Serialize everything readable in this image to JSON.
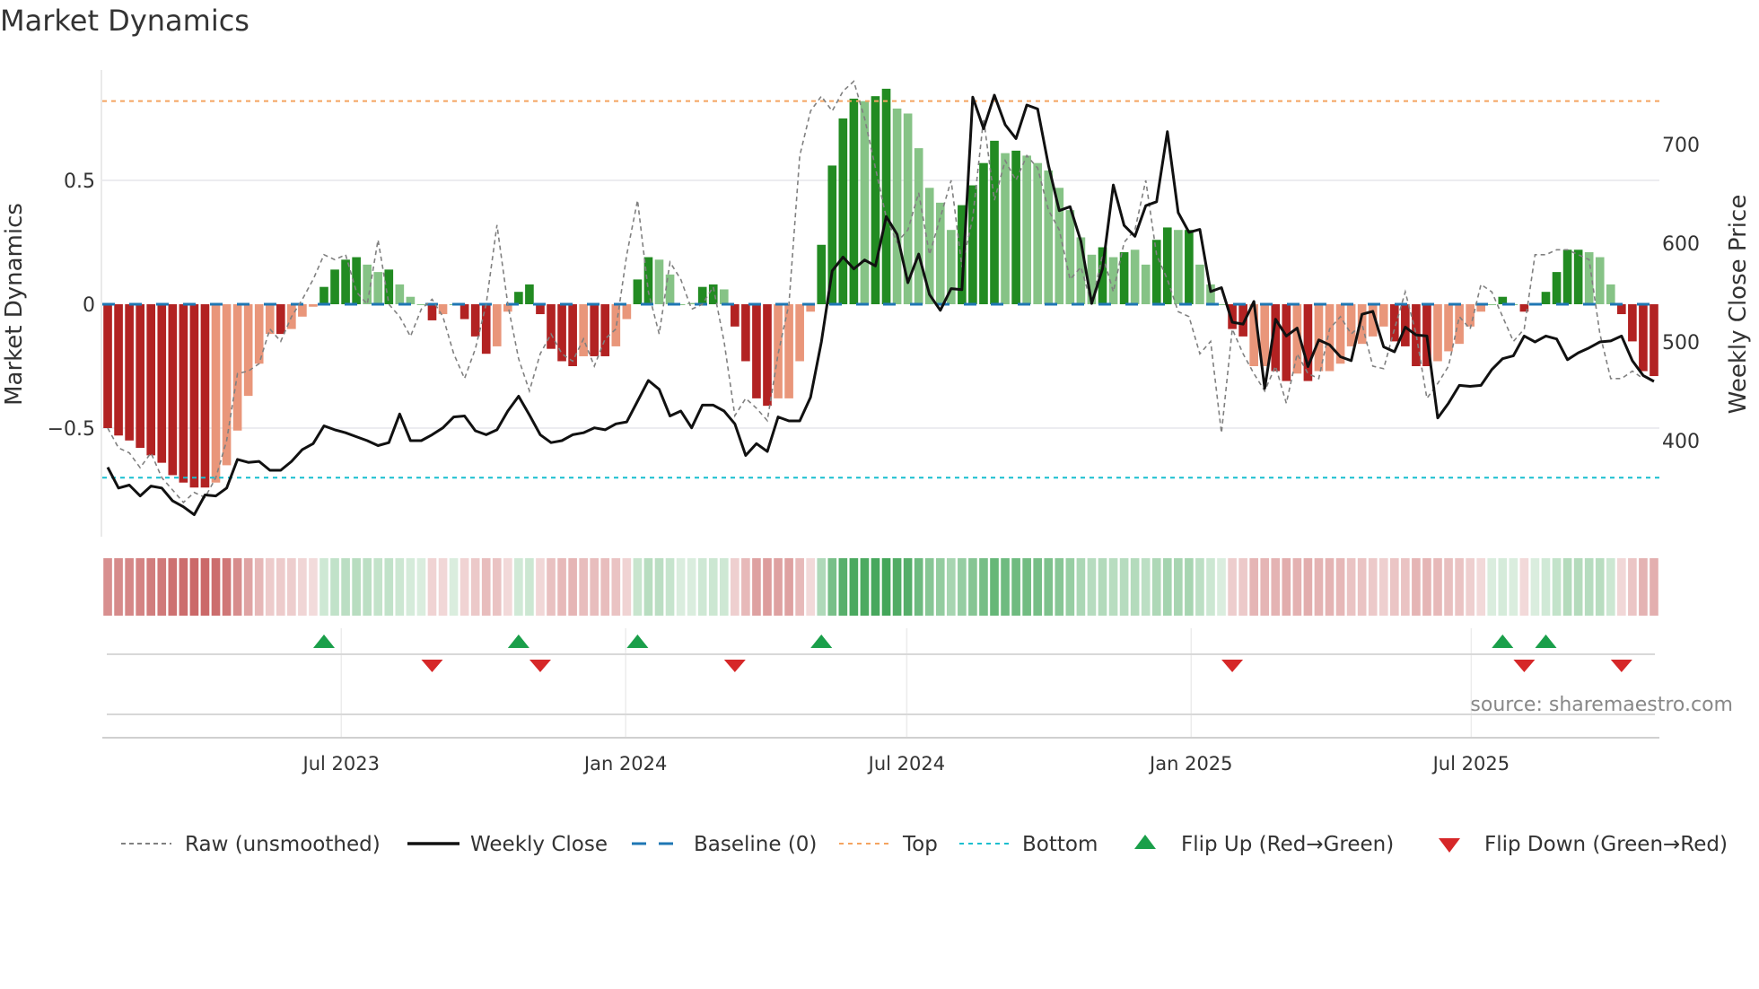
{
  "chart_data": {
    "type": "bar",
    "title": "Market Dynamics",
    "ylabel": "Market Dynamics",
    "y2label": "Weekly Close Price",
    "ylim": [
      -0.87,
      0.94
    ],
    "y2lim": [
      325,
      790
    ],
    "yticks": [
      {
        "v": 0.5,
        "label": "0.5"
      },
      {
        "v": 0,
        "label": "0"
      },
      {
        "v": -0.5,
        "label": "−0.5"
      }
    ],
    "y2ticks": [
      {
        "v": 700,
        "label": "700"
      },
      {
        "v": 600,
        "label": "600"
      },
      {
        "v": 500,
        "label": "500"
      },
      {
        "v": 400,
        "label": "400"
      }
    ],
    "xticks": [
      {
        "week": 21.6,
        "label": "Jul 2023"
      },
      {
        "week": 47.9,
        "label": "Jan 2024"
      },
      {
        "week": 73.9,
        "label": "Jul 2024"
      },
      {
        "week": 100.2,
        "label": "Jan 2025"
      },
      {
        "week": 126.1,
        "label": "Jul 2025"
      }
    ],
    "top_level": 0.82,
    "bottom_level": -0.7,
    "baseline": 0,
    "smoothed": [
      -0.5,
      -0.53,
      -0.55,
      -0.58,
      -0.61,
      -0.64,
      -0.69,
      -0.72,
      -0.74,
      -0.74,
      -0.72,
      -0.65,
      -0.51,
      -0.37,
      -0.24,
      -0.12,
      -0.12,
      -0.1,
      -0.05,
      -0.01,
      0.07,
      0.14,
      0.18,
      0.19,
      0.16,
      0.13,
      0.14,
      0.08,
      0.03,
      0.0,
      -0.065,
      -0.04,
      0.0,
      -0.06,
      -0.13,
      -0.2,
      -0.17,
      -0.03,
      0.05,
      0.08,
      -0.04,
      -0.18,
      -0.23,
      -0.25,
      -0.21,
      -0.21,
      -0.21,
      -0.17,
      -0.06,
      0.1,
      0.19,
      0.18,
      0.12,
      0.0,
      0.005,
      0.07,
      0.08,
      0.06,
      -0.09,
      -0.23,
      -0.38,
      -0.41,
      -0.38,
      -0.38,
      -0.23,
      -0.03,
      0.24,
      0.56,
      0.75,
      0.83,
      0.82,
      0.84,
      0.87,
      0.79,
      0.77,
      0.63,
      0.47,
      0.41,
      0.3,
      0.4,
      0.48,
      0.57,
      0.66,
      0.61,
      0.62,
      0.6,
      0.57,
      0.54,
      0.47,
      0.38,
      0.27,
      0.2,
      0.23,
      0.19,
      0.21,
      0.22,
      0.16,
      0.26,
      0.31,
      0.3,
      0.3,
      0.16,
      0.08,
      0.0,
      -0.1,
      -0.13,
      -0.25,
      -0.25,
      -0.27,
      -0.31,
      -0.28,
      -0.31,
      -0.27,
      -0.27,
      -0.24,
      -0.17,
      -0.16,
      -0.13,
      -0.09,
      -0.15,
      -0.17,
      -0.25,
      -0.25,
      -0.23,
      -0.19,
      -0.16,
      -0.09,
      -0.03,
      0.0,
      0.03,
      0.0,
      -0.03,
      0.0,
      0.05,
      0.13,
      0.22,
      0.22,
      0.21,
      0.19,
      0.08,
      -0.04,
      -0.15,
      -0.27,
      -0.29
    ],
    "strength": "DDDDDDDDDDLLLLLLDLLLDDDDLLDLLLDLLDDDLLDDDDDDLDDLLDDLLLLDDLDDDDLLLLDDDDLDDLLLLLLDDDDLDLLLLLLLDLDLLDDLDLLLDDLLDDLDLLLLLLLDDDDLLLLLLDLDLDDDDLLLDDDD",
    "weekly_close": [
      373,
      352,
      355,
      344,
      354,
      352,
      339,
      333,
      325,
      345,
      344,
      352,
      381,
      378,
      379,
      370,
      370,
      379,
      391,
      397,
      415,
      411,
      408,
      404,
      400,
      395,
      398,
      427,
      400,
      400,
      406,
      413,
      424,
      425,
      410,
      406,
      411,
      430,
      445,
      426,
      406,
      398,
      400,
      406,
      408,
      413,
      411,
      417,
      419,
      440,
      461,
      452,
      425,
      430,
      413,
      436,
      436,
      430,
      417,
      385,
      397,
      389,
      424,
      420,
      420,
      444,
      500,
      572,
      586,
      574,
      583,
      577,
      627,
      609,
      560,
      589,
      548,
      532,
      554,
      553,
      748,
      716,
      750,
      720,
      706,
      740,
      736,
      679,
      633,
      637,
      602,
      539,
      574,
      659,
      618,
      607,
      638,
      642,
      713,
      631,
      611,
      614,
      551,
      555,
      520,
      518,
      541,
      453,
      523,
      506,
      514,
      475,
      502,
      497,
      485,
      481,
      528,
      531,
      495,
      490,
      515,
      507,
      506,
      423,
      438,
      456,
      455,
      456,
      472,
      483,
      486,
      506,
      500,
      506,
      503,
      482,
      489,
      494,
      500,
      501,
      506,
      481,
      466,
      460
    ],
    "raw": [
      -0.5,
      -0.58,
      -0.6,
      -0.66,
      -0.6,
      -0.7,
      -0.75,
      -0.8,
      -0.76,
      -0.78,
      -0.7,
      -0.55,
      -0.28,
      -0.27,
      -0.24,
      -0.1,
      -0.15,
      -0.05,
      0.02,
      0.1,
      0.2,
      0.18,
      0.2,
      0.05,
      0.0,
      0.26,
      0.0,
      -0.05,
      -0.13,
      -0.02,
      0.02,
      -0.05,
      -0.2,
      -0.3,
      -0.18,
      0.0,
      0.32,
      0.0,
      -0.22,
      -0.35,
      -0.2,
      -0.12,
      -0.2,
      -0.23,
      -0.14,
      -0.25,
      -0.14,
      -0.1,
      0.2,
      0.42,
      0.05,
      -0.12,
      0.17,
      0.1,
      -0.02,
      0.0,
      0.07,
      -0.15,
      -0.45,
      -0.38,
      -0.42,
      -0.47,
      -0.2,
      0.0,
      0.6,
      0.78,
      0.84,
      0.78,
      0.86,
      0.9,
      0.75,
      0.55,
      0.35,
      0.25,
      0.3,
      0.45,
      0.2,
      0.35,
      0.5,
      0.15,
      0.35,
      0.75,
      0.42,
      0.58,
      0.5,
      0.6,
      0.55,
      0.38,
      0.3,
      0.1,
      0.15,
      0.0,
      0.2,
      0.05,
      0.25,
      0.3,
      0.5,
      0.2,
      0.1,
      -0.03,
      -0.05,
      -0.2,
      -0.15,
      -0.52,
      -0.1,
      -0.2,
      -0.28,
      -0.35,
      -0.25,
      -0.4,
      -0.2,
      -0.28,
      -0.3,
      -0.1,
      -0.05,
      -0.12,
      -0.08,
      -0.25,
      -0.26,
      -0.1,
      0.05,
      -0.12,
      -0.38,
      -0.32,
      -0.25,
      -0.05,
      -0.1,
      0.08,
      0.05,
      -0.05,
      -0.15,
      -0.1,
      0.2,
      0.2,
      0.22,
      0.22,
      0.2,
      0.18,
      -0.12,
      -0.3,
      -0.3,
      -0.27,
      -0.3
    ],
    "flip_up_weeks": [
      20,
      38,
      49,
      66,
      129,
      133
    ],
    "flip_down_weeks": [
      30,
      40,
      58,
      104,
      131,
      140
    ],
    "source": "source: sharemaestro.com",
    "legend": [
      {
        "key": "raw",
        "label": "Raw (unsmoothed)"
      },
      {
        "key": "close",
        "label": "Weekly Close"
      },
      {
        "key": "baseline",
        "label": "Baseline (0)"
      },
      {
        "key": "top",
        "label": "Top"
      },
      {
        "key": "bottom",
        "label": "Bottom"
      },
      {
        "key": "flipup",
        "label": "Flip Up (Red→Green)"
      },
      {
        "key": "flipdown",
        "label": "Flip Down (Green→Red)"
      }
    ],
    "legend_placement": "bottom",
    "colors": {
      "pos_strong": "#228b22",
      "pos_weak": "#86c386",
      "neg_strong": "#b22222",
      "neg_weak": "#e9967a",
      "baseline": "#1f77b4",
      "top": "#f4a460",
      "bottom": "#17becf",
      "flip_up": "#1a9f4a",
      "flip_down": "#d62728",
      "close": "#111111",
      "raw": "#808080"
    }
  }
}
